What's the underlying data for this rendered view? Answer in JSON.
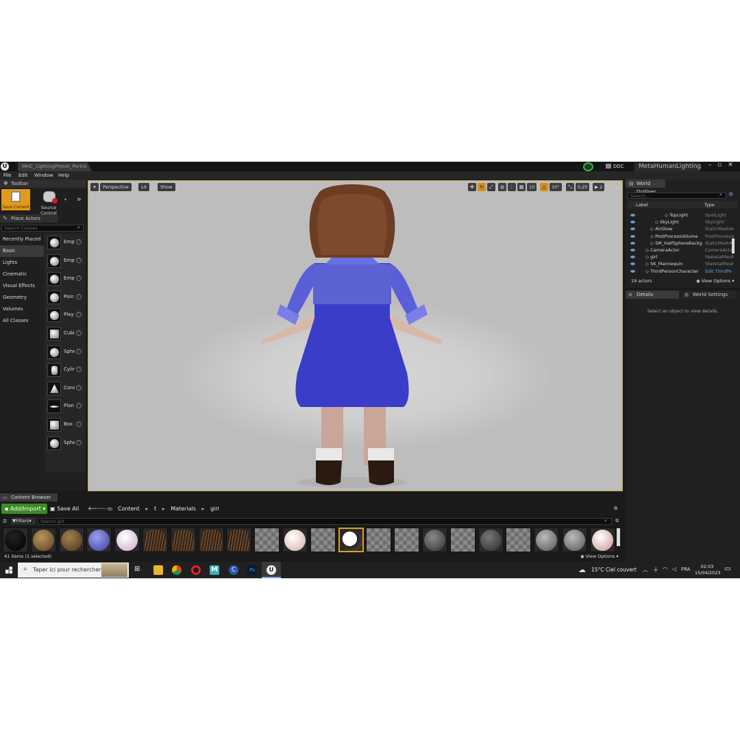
{
  "window": {
    "tab_title": "MHC_LightingPreset_Portra",
    "ddc_label": "DDC",
    "project_name": "MetaHumanLighting"
  },
  "menu": [
    "File",
    "Edit",
    "Window",
    "Help"
  ],
  "toolbar": {
    "tab": "Toolbar",
    "save_current": "Save Current",
    "source_control": "Source Control"
  },
  "place_actors": {
    "tab": "Place Actors",
    "search_placeholder": "Search Classes",
    "categories": [
      "Recently Placed",
      "Basic",
      "Lights",
      "Cinematic",
      "Visual Effects",
      "Geometry",
      "Volumes",
      "All Classes"
    ],
    "active_category": "Basic",
    "actors": [
      "Emp",
      "Emp",
      "Emp",
      "Poin",
      "Play",
      "Cubi",
      "Sphe",
      "Cylir",
      "Cone",
      "Plan",
      "Box",
      "Sphe"
    ]
  },
  "viewport": {
    "perspective": "Perspective",
    "lit": "Lit",
    "show": "Show",
    "grid_snap": "10",
    "rot_snap": "10°",
    "scale_snap": "0,25",
    "camera_speed": "2"
  },
  "world_outliner": {
    "tab": "World Outliner",
    "search_placeholder": "Search...",
    "col_label": "Label",
    "col_type": "Type",
    "rows": [
      {
        "name": "TopLight",
        "type": "SpotLight"
      },
      {
        "name": "SkyLight",
        "type": "SkyLight"
      },
      {
        "name": "AirGlow",
        "type": "StaticMeshAc"
      },
      {
        "name": "PostProcessVolume",
        "type": "PostProcessV"
      },
      {
        "name": "SM_HalfSphereBackg",
        "type": "StaticMeshAc"
      },
      {
        "name": "CameraActor",
        "type": "CameraActor"
      },
      {
        "name": "girl",
        "type": "SkeletalMesh"
      },
      {
        "name": "SK_Mannequin",
        "type": "SkeletalMesh"
      },
      {
        "name": "ThirdPersonCharacter",
        "type": "Edit ThirdPe"
      }
    ],
    "count": "19 actors",
    "view_options": "View Options"
  },
  "details": {
    "tab_details": "Details",
    "tab_world_settings": "World Settings",
    "empty_message": "Select an object to view details."
  },
  "content_browser": {
    "tab": "Content Browser",
    "add_import": "Add/Import",
    "save_all": "Save All",
    "path": [
      "Content",
      "t",
      "Materials",
      "girl"
    ],
    "filters": "Filters",
    "search_placeholder": "Search girl",
    "status": "41 items (1 selected)",
    "view_options": "View Options"
  },
  "taskbar": {
    "search_placeholder": "Taper ici pour rechercher",
    "weather": "15°C  Ciel couvert",
    "language": "FRA",
    "time": "02:03",
    "date": "15/04/2023"
  }
}
